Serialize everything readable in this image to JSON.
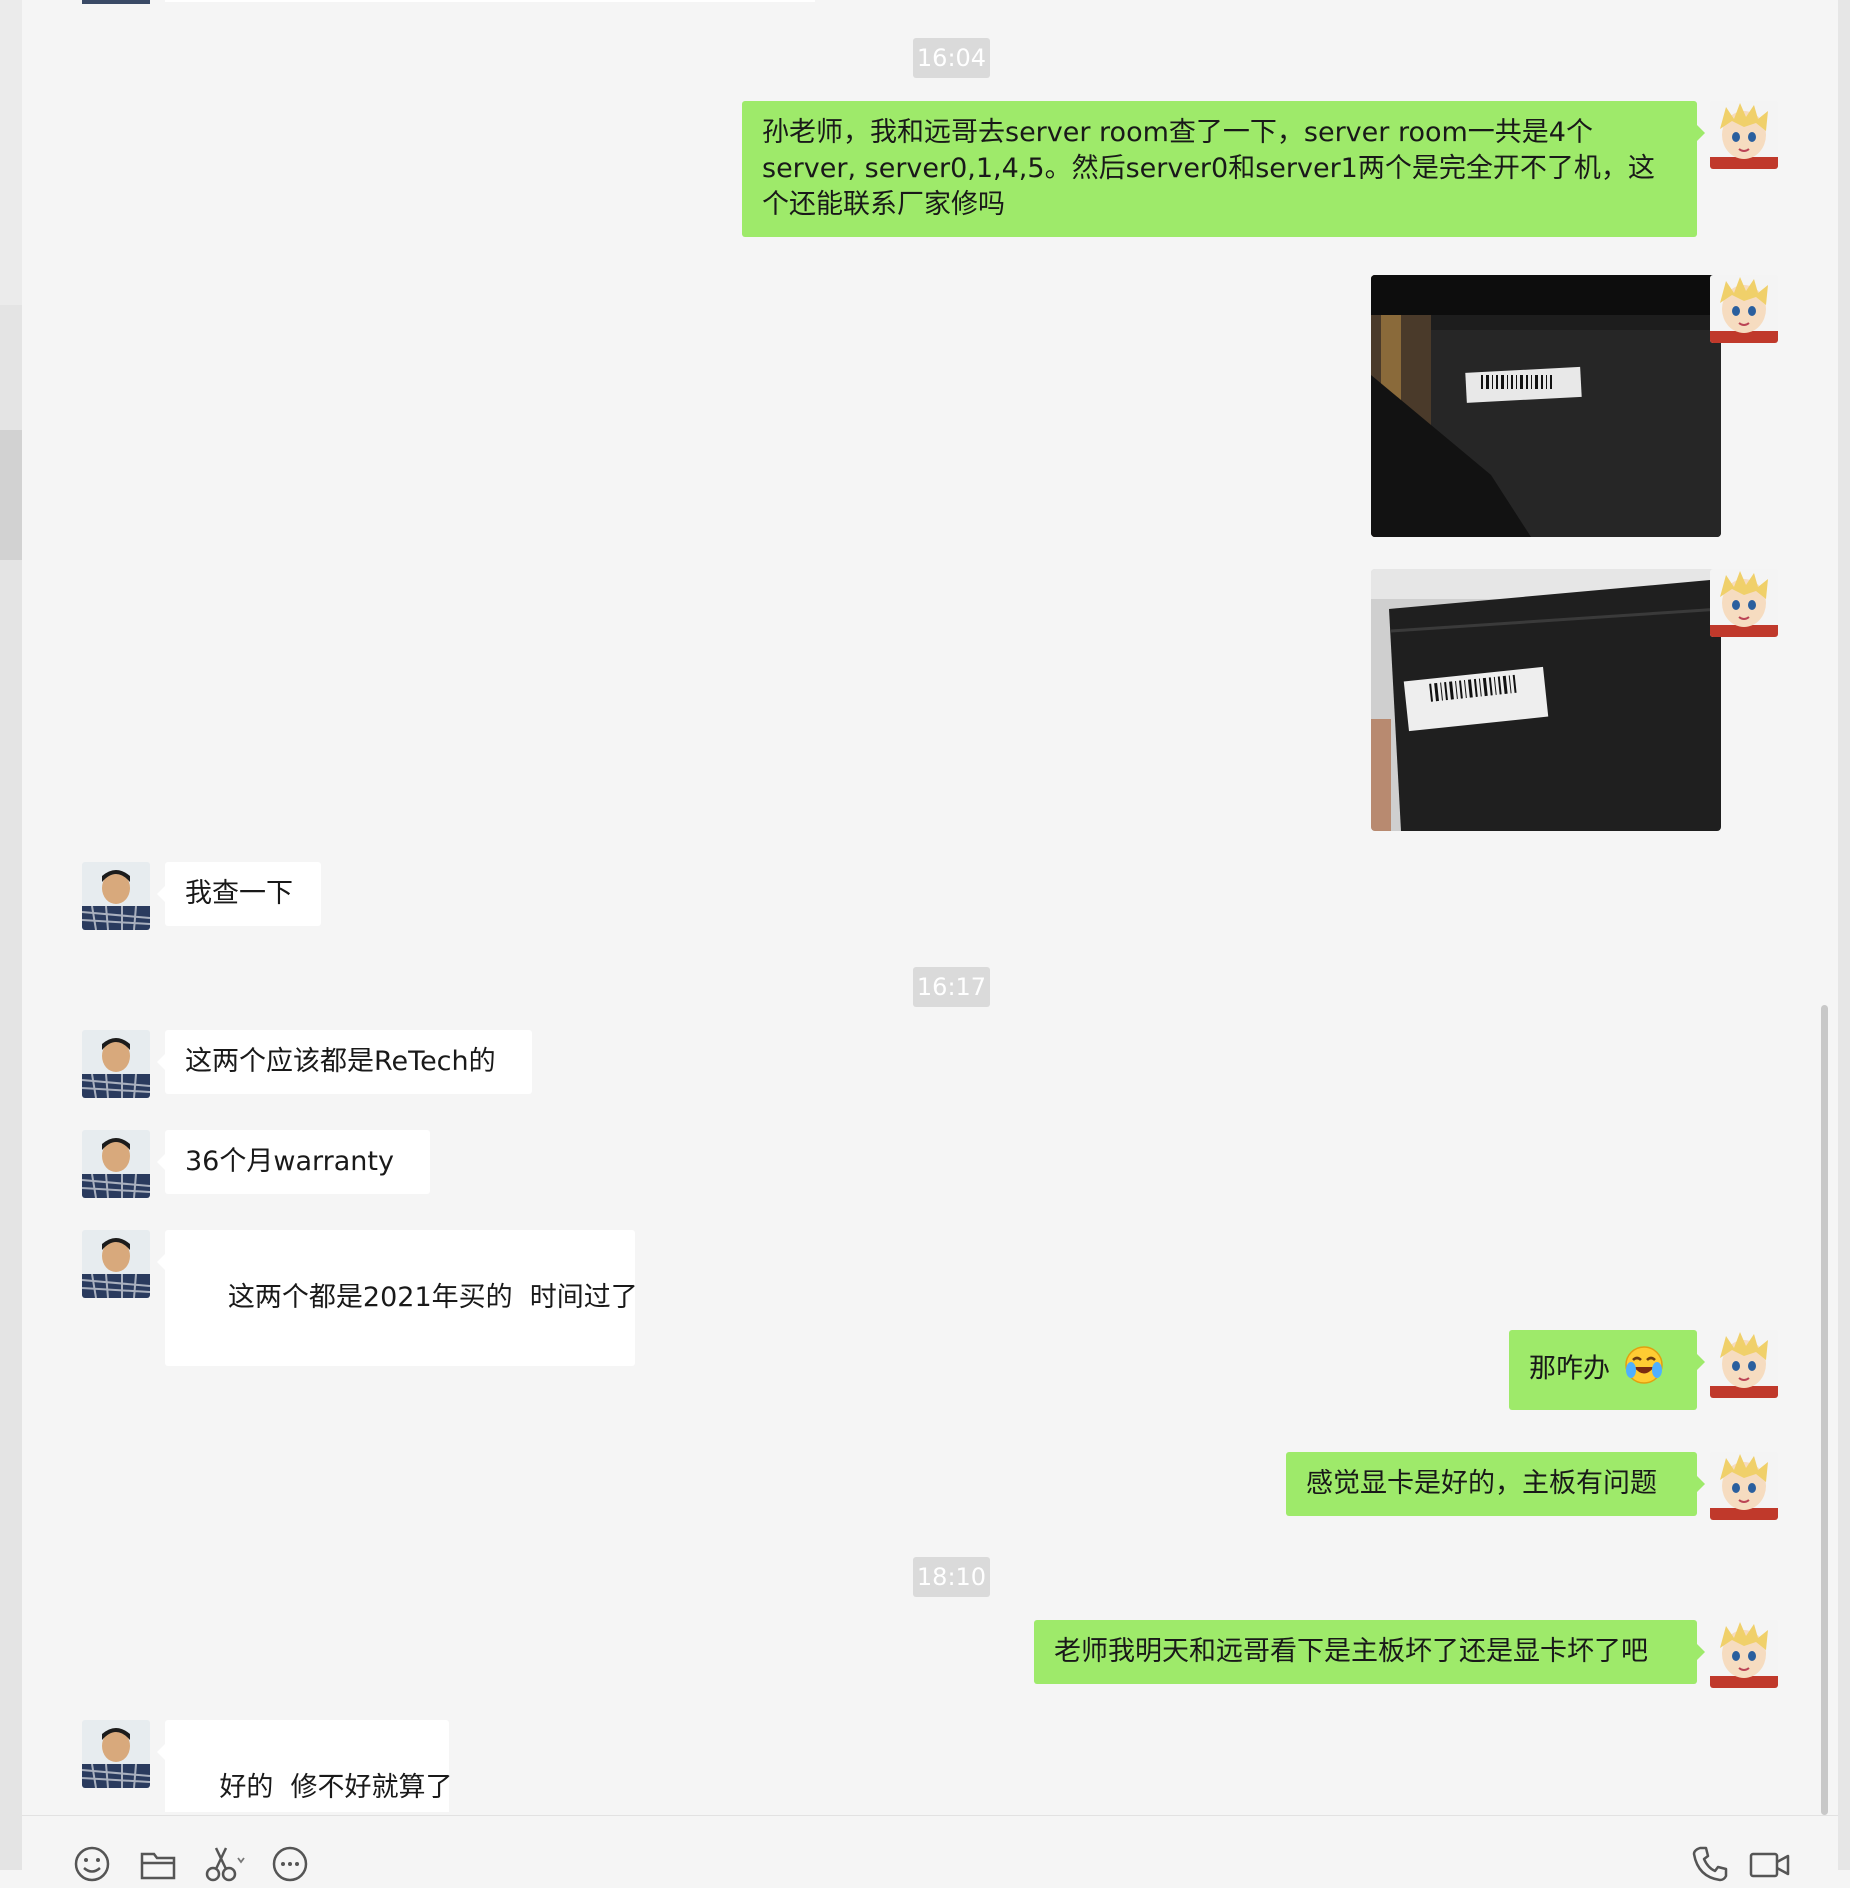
{
  "timestamps": [
    "16:04",
    "16:17",
    "18:10"
  ],
  "messages": {
    "m1": "孙老师，我和远哥去server room查了一下，server room一共是4个server, server0,1,4,5。然后server0和server1两个是完全开不了机，这个还能联系厂家修吗",
    "m2": "我查一下",
    "m3": "这两个应该都是ReTech的",
    "m4": "36个月warranty",
    "m5": " 这两个都是2021年买的  时间过了",
    "m6": "那咋办",
    "m7": "感觉显卡是好的，主板有问题",
    "m8": "老师我明天和远哥看下是主板坏了还是显卡坏了吧",
    "m9": "好的  修不好就算了"
  },
  "toolbar_icons": [
    "emoji-icon",
    "folder-icon",
    "scissors-icon",
    "more-icon",
    "phone-icon",
    "video-icon"
  ],
  "colors": {
    "background": "#f5f5f5",
    "bubble_out": "#9eea6a",
    "bubble_in": "#ffffff",
    "timestamp_bg": "#dadada"
  }
}
